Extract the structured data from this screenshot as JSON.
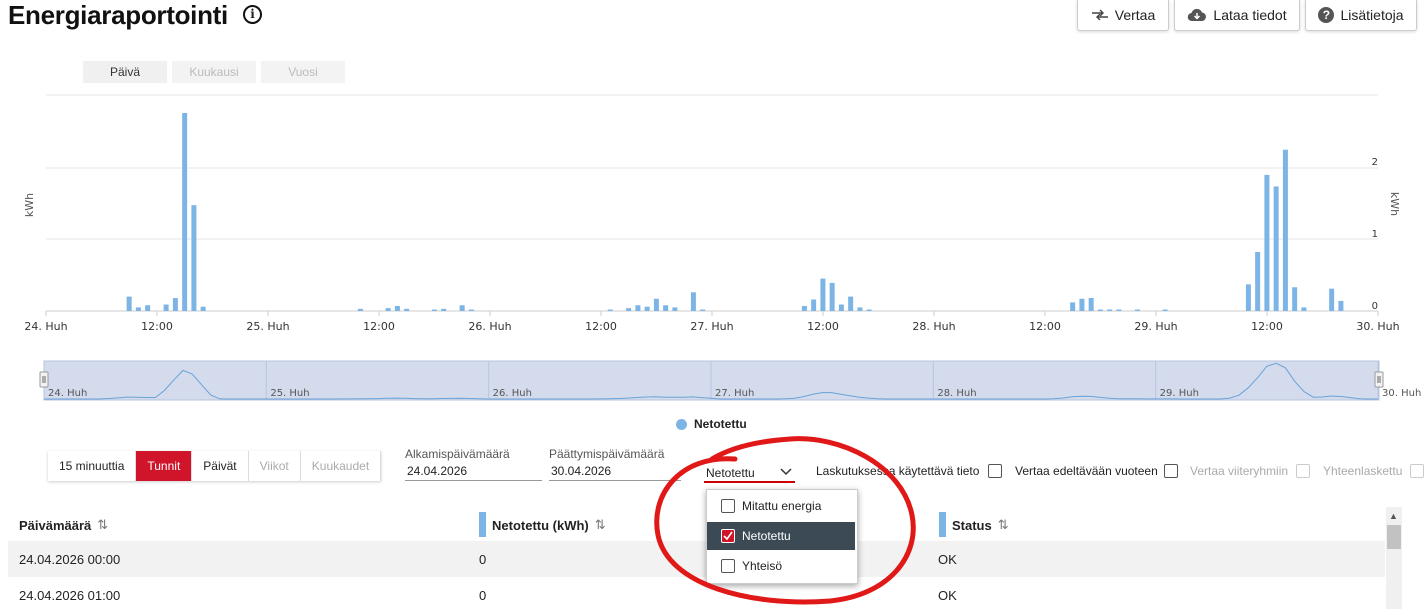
{
  "page": {
    "title": "Energiaraportointi",
    "info_icon": "info-circle-icon"
  },
  "toolbar": {
    "compare_label": "Vertaa",
    "download_label": "Lataa tiedot",
    "more_info_label": "Lisätietoja"
  },
  "period_tabs": [
    {
      "label": "Päivä",
      "active": true
    },
    {
      "label": "Kuukausi",
      "active": false
    },
    {
      "label": "Vuosi",
      "active": false
    }
  ],
  "chart_data": {
    "type": "bar",
    "ylabel_left": "kWh",
    "ylabel_right": "kWh",
    "y_ticks_right": [
      "0",
      "1",
      "2"
    ],
    "x_tick_labels": [
      "24. Huh",
      "12:00",
      "25. Huh",
      "12:00",
      "26. Huh",
      "12:00",
      "27. Huh",
      "12:00",
      "28. Huh",
      "12:00",
      "29. Huh",
      "12:00",
      "30. Huh"
    ],
    "navigator_labels": [
      "24. Huh",
      "25. Huh",
      "26. Huh",
      "27. Huh",
      "28. Huh",
      "29. Huh",
      "30. Huh"
    ],
    "ylim": [
      0,
      3
    ],
    "x_unit": "hours since 24.04.2026 00:00",
    "series": [
      {
        "name": "Netotettu",
        "color": "#7db4e6",
        "points": [
          [
            9,
            0.2
          ],
          [
            10,
            0.05
          ],
          [
            11,
            0.08
          ],
          [
            13,
            0.09
          ],
          [
            14,
            0.18
          ],
          [
            15,
            2.75
          ],
          [
            16,
            1.47
          ],
          [
            17,
            0.06
          ],
          [
            34,
            0.03
          ],
          [
            37,
            0.04
          ],
          [
            38,
            0.07
          ],
          [
            39,
            0.03
          ],
          [
            42,
            0.02
          ],
          [
            43,
            0.03
          ],
          [
            45,
            0.08
          ],
          [
            46,
            0.02
          ],
          [
            61,
            0.02
          ],
          [
            63,
            0.04
          ],
          [
            64,
            0.08
          ],
          [
            65,
            0.06
          ],
          [
            66,
            0.17
          ],
          [
            67,
            0.08
          ],
          [
            68,
            0.05
          ],
          [
            70,
            0.26
          ],
          [
            71,
            0.02
          ],
          [
            82,
            0.07
          ],
          [
            83,
            0.16
          ],
          [
            84,
            0.45
          ],
          [
            85,
            0.39
          ],
          [
            86,
            0.09
          ],
          [
            87,
            0.2
          ],
          [
            88,
            0.05
          ],
          [
            89,
            0.02
          ],
          [
            111,
            0.12
          ],
          [
            112,
            0.17
          ],
          [
            113,
            0.18
          ],
          [
            114,
            0.02
          ],
          [
            115,
            0.02
          ],
          [
            116,
            0.02
          ],
          [
            118,
            0.02
          ],
          [
            121,
            0.02
          ],
          [
            130,
            0.37
          ],
          [
            131,
            0.82
          ],
          [
            132,
            1.89
          ],
          [
            133,
            1.73
          ],
          [
            134,
            2.24
          ],
          [
            135,
            0.33
          ],
          [
            136,
            0.05
          ],
          [
            139,
            0.31
          ],
          [
            140,
            0.14
          ]
        ]
      }
    ]
  },
  "legend": {
    "label": "Netotettu",
    "color": "#7db4e6"
  },
  "resolution": [
    {
      "label": "15 minuuttia",
      "state": "normal"
    },
    {
      "label": "Tunnit",
      "state": "active"
    },
    {
      "label": "Päivät",
      "state": "normal"
    },
    {
      "label": "Viikot",
      "state": "disabled"
    },
    {
      "label": "Kuukaudet",
      "state": "disabled"
    }
  ],
  "start_date": {
    "label": "Alkamispäivämäärä",
    "value": "24.04.2026"
  },
  "end_date": {
    "label": "Päättymispäivämäärä",
    "value": "30.04.2026"
  },
  "series_select": {
    "value": "Netotettu",
    "options": [
      {
        "label": "Mitattu energia",
        "checked": false
      },
      {
        "label": "Netotettu",
        "checked": true
      },
      {
        "label": "Yhteisö",
        "checked": false
      }
    ]
  },
  "options": {
    "billing_label": "Laskutuksessa käytettävä tieto",
    "compare_prev_year_label": "Vertaa edeltävään vuoteen",
    "compare_reference_label": "Vertaa viiteryhmiin",
    "sum_label": "Yhteenlaskettu"
  },
  "table": {
    "columns": [
      "Päivämäärä",
      "Netotettu (kWh)",
      "Status"
    ],
    "rows": [
      [
        "24.04.2026 00:00",
        "0",
        "OK"
      ],
      [
        "24.04.2026 01:00",
        "0",
        "OK"
      ]
    ]
  },
  "colors": {
    "accent": "#d0152a",
    "series": "#7db4e6",
    "selected_item_bg": "#3c4a55"
  }
}
